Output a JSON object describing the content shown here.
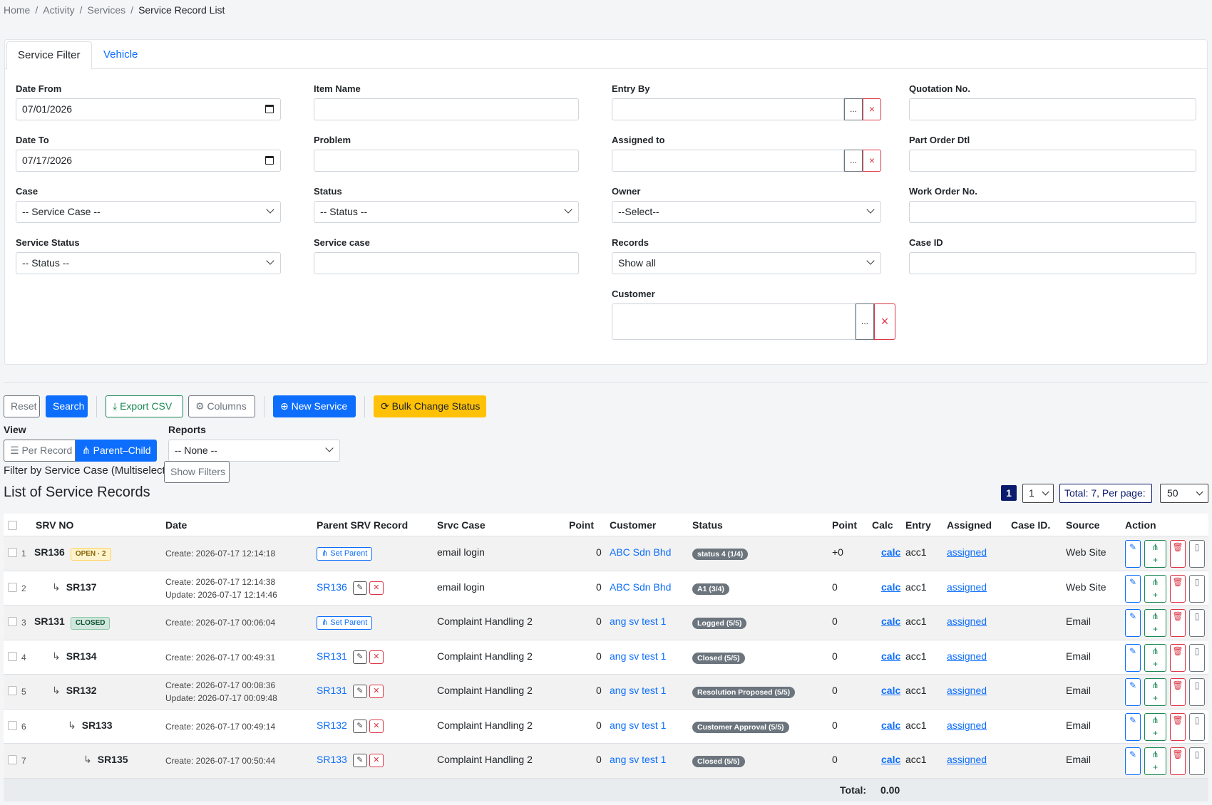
{
  "breadcrumb": {
    "home": "Home",
    "activity": "Activity",
    "services": "Services",
    "current": "Service Record List",
    "sep": "/"
  },
  "tabs": {
    "service_filter": "Service Filter",
    "vehicle": "Vehicle"
  },
  "filters": {
    "date_from": {
      "label": "Date From",
      "value": "07/01/2026"
    },
    "date_to": {
      "label": "Date To",
      "value": "07/17/2026"
    },
    "case": {
      "label": "Case",
      "value": "-- Service Case --"
    },
    "service_status": {
      "label": "Service Status",
      "value": "-- Status --"
    },
    "item_name": {
      "label": "Item Name",
      "value": ""
    },
    "problem": {
      "label": "Problem",
      "value": ""
    },
    "status": {
      "label": "Status",
      "value": "-- Status --"
    },
    "service_case": {
      "label": "Service case",
      "value": ""
    },
    "entry_by": {
      "label": "Entry By",
      "value": ""
    },
    "assigned_to": {
      "label": "Assigned to",
      "value": ""
    },
    "owner": {
      "label": "Owner",
      "value": "--Select--"
    },
    "records": {
      "label": "Records",
      "value": "Show all"
    },
    "customer": {
      "label": "Customer",
      "value": ""
    },
    "quotation_no": {
      "label": "Quotation No.",
      "value": ""
    },
    "part_order_dtl": {
      "label": "Part Order Dtl",
      "value": ""
    },
    "work_order_no": {
      "label": "Work Order No.",
      "value": ""
    },
    "case_id": {
      "label": "Case ID",
      "value": ""
    },
    "pick_label": "...",
    "clear_label": "×"
  },
  "toolbar": {
    "reset": "Reset",
    "search": "Search",
    "export_csv": "Export CSV",
    "columns": "Columns",
    "new_service": "New Service",
    "bulk_change_status": "Bulk Change Status"
  },
  "view": {
    "label": "View",
    "per_record": "Per Record",
    "parent_child": "Parent–Child"
  },
  "reports": {
    "label": "Reports",
    "value": "-- None --"
  },
  "filter_by_case": "Filter by Service Case (Multiselect)",
  "show_filters": "Show Filters",
  "list_title": "List of Service Records",
  "pagination": {
    "current_page": "1",
    "page_select": "1",
    "total_text": "Total: 7, Per page:",
    "per_page": "50"
  },
  "columns": {
    "srv_no": "SRV NO",
    "date": "Date",
    "parent": "Parent SRV Record",
    "srvc_case": "Srvc Case",
    "point": "Point",
    "customer": "Customer",
    "status": "Status",
    "point2": "Point",
    "calc": "Calc",
    "entry": "Entry",
    "assigned": "Assigned",
    "case_id": "Case ID.",
    "source": "Source",
    "action": "Action"
  },
  "set_parent_label": "Set Parent",
  "rows": [
    {
      "no": "1",
      "srv": "SR136",
      "badge": "OPEN · 2",
      "level": 0,
      "create": "Create: 2026-07-17 12:14:18",
      "update": "",
      "parent": "",
      "srvc_case": "email login",
      "point": "0",
      "customer": "ABC Sdn Bhd",
      "status": "status 4 (1/4)",
      "point2": "+0",
      "calc": "calc",
      "entry": "acc1",
      "assigned": "assigned",
      "source": "Web Site"
    },
    {
      "no": "2",
      "srv": "SR137",
      "badge": "",
      "level": 1,
      "create": "Create: 2026-07-17 12:14:38",
      "update": "Update: 2026-07-17 12:14:46",
      "parent": "SR136",
      "srvc_case": "email login",
      "point": "0",
      "customer": "ABC Sdn Bhd",
      "status": "A1 (3/4)",
      "point2": "0",
      "calc": "calc",
      "entry": "acc1",
      "assigned": "assigned",
      "source": "Web Site"
    },
    {
      "no": "3",
      "srv": "SR131",
      "badge": "CLOSED",
      "level": 0,
      "create": "Create: 2026-07-17 00:06:04",
      "update": "",
      "parent": "",
      "srvc_case": "Complaint Handling 2",
      "point": "0",
      "customer": "ang sv test 1",
      "status": "Logged (5/5)",
      "point2": "0",
      "calc": "calc",
      "entry": "acc1",
      "assigned": "assigned",
      "source": "Email"
    },
    {
      "no": "4",
      "srv": "SR134",
      "badge": "",
      "level": 1,
      "create": "Create: 2026-07-17 00:49:31",
      "update": "",
      "parent": "SR131",
      "srvc_case": "Complaint Handling 2",
      "point": "0",
      "customer": "ang sv test 1",
      "status": "Closed (5/5)",
      "point2": "0",
      "calc": "calc",
      "entry": "acc1",
      "assigned": "assigned",
      "source": "Email"
    },
    {
      "no": "5",
      "srv": "SR132",
      "badge": "",
      "level": 1,
      "create": "Create: 2026-07-17 00:08:36",
      "update": "Update: 2026-07-17 00:09:48",
      "parent": "SR131",
      "srvc_case": "Complaint Handling 2",
      "point": "0",
      "customer": "ang sv test 1",
      "status": "Resolution Proposed (5/5)",
      "point2": "0",
      "calc": "calc",
      "entry": "acc1",
      "assigned": "assigned",
      "source": "Email"
    },
    {
      "no": "6",
      "srv": "SR133",
      "badge": "",
      "level": 2,
      "create": "Create: 2026-07-17 00:49:14",
      "update": "",
      "parent": "SR132",
      "srvc_case": "Complaint Handling 2",
      "point": "0",
      "customer": "ang sv test 1",
      "status": "Customer Approval (5/5)",
      "point2": "0",
      "calc": "calc",
      "entry": "acc1",
      "assigned": "assigned",
      "source": "Email"
    },
    {
      "no": "7",
      "srv": "SR135",
      "badge": "",
      "level": 3,
      "create": "Create: 2026-07-17 00:50:44",
      "update": "",
      "parent": "SR133",
      "srvc_case": "Complaint Handling 2",
      "point": "0",
      "customer": "ang sv test 1",
      "status": "Closed (5/5)",
      "point2": "0",
      "calc": "calc",
      "entry": "acc1",
      "assigned": "assigned",
      "source": "Email"
    }
  ],
  "total": {
    "label": "Total:",
    "value": "0.00"
  }
}
